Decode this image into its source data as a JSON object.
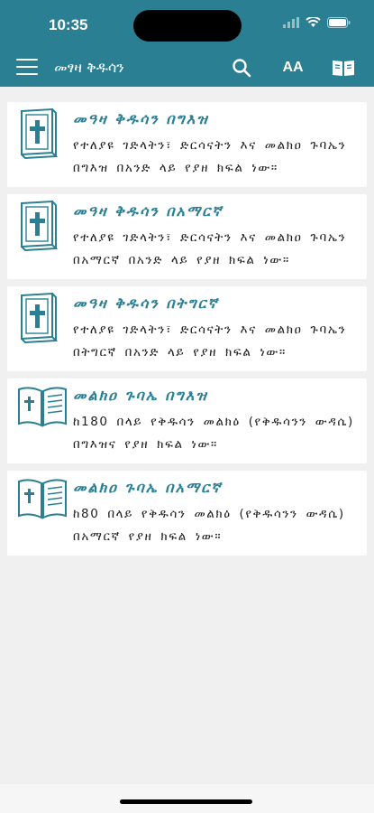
{
  "status": {
    "time": "10:35"
  },
  "appbar": {
    "title": "መፃዛ ቅዱሳን",
    "icons": [
      "menu-icon",
      "search-icon",
      "font-size-icon",
      "book-open-icon"
    ],
    "font_label": "AA"
  },
  "colors": {
    "accent": "#2a7f93",
    "background": "#f0f0f0",
    "card": "#ffffff"
  },
  "items": [
    {
      "icon": "bible-icon",
      "title": "መዓዛ ቅዱሳን በግእዝ",
      "desc": "የተለያዩ ገድላትን፣ ድርሳናትን እና መልክዐ ጉባኤን በግእዝ በአንድ ላይ የያዘ ክፍል ነው።"
    },
    {
      "icon": "bible-icon",
      "title": "መዓዛ ቅዱሳን በአማርኛ",
      "desc": "የተለያዩ ገድላትን፣ ድርሳናትን እና መልክዐ ጉባኤን በአማርኛ በአንድ ላይ የያዘ ክፍል ነው።"
    },
    {
      "icon": "bible-icon",
      "title": "መዓዛ ቅዱሳን በትግርኛ",
      "desc": "የተለያዩ ገድላትን፣ ድርሳናትን እና መልክዐ ጉባኤን በትግርኛ በአንድ ላይ የያዘ ክፍል ነው።"
    },
    {
      "icon": "open-book-icon",
      "title": "መልክዐ ጉባኤ በግእዝ",
      "desc": "ከ180 በላይ የቅዱሳን መልክዕ (የቅዱሳንን ውዳሴ) በግእዝና የያዘ ክፍል ነው።"
    },
    {
      "icon": "open-book-icon",
      "title": "መልክዐ ጉባኤ በአማርኛ",
      "desc": "ከ80 በላይ የቅዱሳን መልክዕ (የቅዱሳንን ውዳሴ) በአማርኛ የያዘ ክፍል ነው።"
    }
  ]
}
